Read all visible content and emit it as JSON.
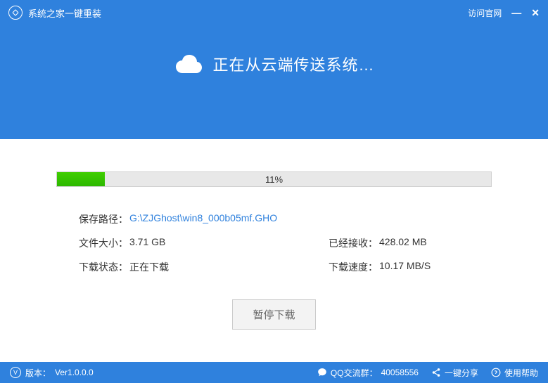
{
  "header": {
    "app_title": "系统之家一键重装",
    "visit_official": "访问官网"
  },
  "hero": {
    "status_text": "正在从云端传送系统…"
  },
  "progress": {
    "percent": 11,
    "percent_text": "11%"
  },
  "info": {
    "save_path_label": "保存路径：",
    "save_path_value": "G:\\ZJGhost\\win8_000b05mf.GHO",
    "file_size_label": "文件大小：",
    "file_size_value": "3.71 GB",
    "received_label": "已经接收：",
    "received_value": "428.02 MB",
    "status_label": "下载状态：",
    "status_value": "正在下载",
    "speed_label": "下载速度：",
    "speed_value": "10.17 MB/S"
  },
  "buttons": {
    "pause": "暂停下载"
  },
  "footer": {
    "version_label": "版本：",
    "version_value": "Ver1.0.0.0",
    "qq_group_label": "QQ交流群：",
    "qq_group_value": "40058556",
    "share": "一键分享",
    "help": "使用帮助"
  }
}
